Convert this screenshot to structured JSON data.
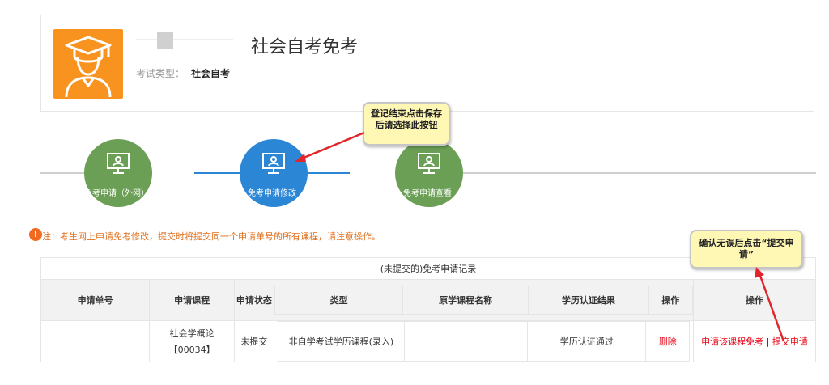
{
  "header": {
    "title": "社会自考免考",
    "exam_type_label": "考试类型：",
    "exam_type_value": "社会自考"
  },
  "steps": [
    {
      "label": "免考申请（外网）",
      "color": "#6a9f55"
    },
    {
      "label": "免考申请修改",
      "color": "#2b86d6"
    },
    {
      "label": "免考申请查看",
      "color": "#6a9f55"
    }
  ],
  "callouts": {
    "save_hint": "登记结束点击保存后请选择此按钮",
    "submit_hint": "确认无误后点击“提交申请”"
  },
  "notice": "注：考生网上申请免考修改，提交时将提交同一个申请单号的所有课程，请注意操作。",
  "table": {
    "caption": "(未提交的)免考申请记录",
    "headers": {
      "order_no": "申请单号",
      "course": "申请课程",
      "status": "申请状态",
      "type": "类型",
      "orig_course": "原学课程名称",
      "cert_result": "学历认证结果",
      "op_inner": "操作",
      "op": "操作"
    },
    "rows": [
      {
        "order_no": "",
        "course_name": "社会学概论",
        "course_code": "【00034】",
        "status": "未提交",
        "type": "非自学考试学历课程(录入)",
        "orig_course": "",
        "cert_result": "学历认证通过",
        "delete": "删除",
        "apply_link": "申请该课程免考",
        "separator": "|",
        "submit_link": "提交申请"
      }
    ]
  },
  "colors": {
    "avatar_bg": "#f7931e",
    "accent_orange": "#e06f1c",
    "link_red": "#e60012",
    "step_active": "#2b86d6",
    "step_inactive": "#6a9f55"
  }
}
